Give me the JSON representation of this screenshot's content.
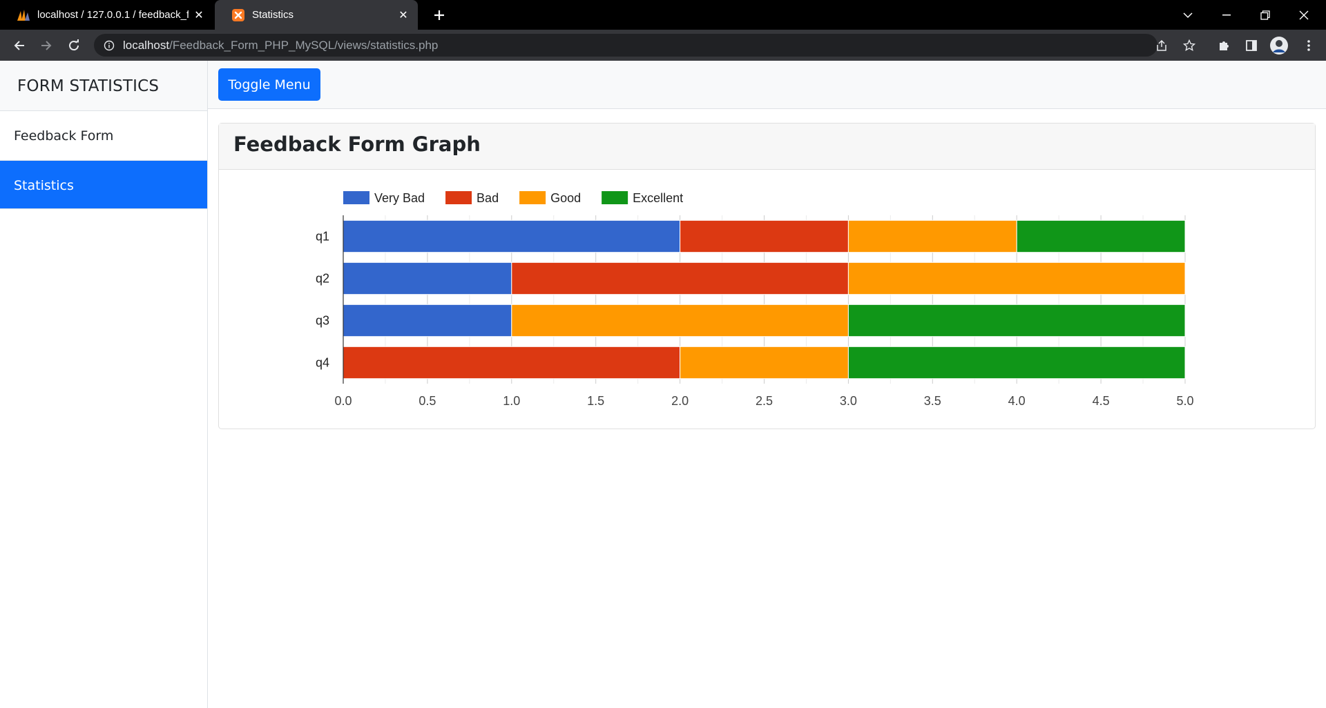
{
  "browser": {
    "tabs": [
      {
        "title": "localhost / 127.0.0.1 / feedback_f",
        "favicon": "phpmyadmin-icon"
      },
      {
        "title": "Statistics",
        "favicon": "xampp-icon"
      }
    ],
    "url_host": "localhost",
    "url_path": "/Feedback_Form_PHP_MySQL/views/statistics.php"
  },
  "sidebar": {
    "heading": "FORM STATISTICS",
    "items": [
      {
        "label": "Feedback Form",
        "active": false
      },
      {
        "label": "Statistics",
        "active": true
      }
    ]
  },
  "topnav": {
    "toggle_label": "Toggle Menu"
  },
  "card": {
    "title": "Feedback Form Graph"
  },
  "colors": {
    "primary": "#0d6efd",
    "very_bad": "#3366cc",
    "bad": "#dc3912",
    "good": "#ff9900",
    "excellent": "#109618"
  },
  "chart_data": {
    "type": "bar",
    "orientation": "horizontal",
    "stacked": true,
    "categories": [
      "q1",
      "q2",
      "q3",
      "q4"
    ],
    "series": [
      {
        "name": "Very Bad",
        "color": "#3366cc",
        "values": [
          2,
          1,
          1,
          0
        ]
      },
      {
        "name": "Bad",
        "color": "#dc3912",
        "values": [
          1,
          2,
          0,
          2
        ]
      },
      {
        "name": "Good",
        "color": "#ff9900",
        "values": [
          1,
          2,
          2,
          1
        ]
      },
      {
        "name": "Excellent",
        "color": "#109618",
        "values": [
          1,
          0,
          2,
          2
        ]
      }
    ],
    "xlim": [
      0,
      5
    ],
    "xticks": [
      "0.0",
      "0.5",
      "1.0",
      "1.5",
      "2.0",
      "2.5",
      "3.0",
      "3.5",
      "4.0",
      "4.5",
      "5.0"
    ],
    "grid": true,
    "legend_position": "top"
  }
}
